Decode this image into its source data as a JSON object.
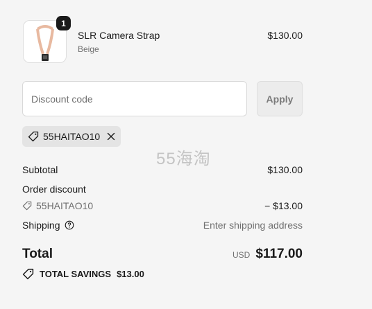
{
  "product": {
    "quantity": "1",
    "name": "SLR Camera Strap",
    "variant": "Beige",
    "price": "$130.00"
  },
  "discount": {
    "placeholder": "Discount code",
    "value": "",
    "apply_label": "Apply"
  },
  "applied_code": {
    "code": "55HAITAO10",
    "icon": "tag-icon",
    "remove_icon": "close-icon"
  },
  "watermark": "55海淘",
  "summary": {
    "subtotal_label": "Subtotal",
    "subtotal_value": "$130.00",
    "order_discount_label": "Order discount",
    "order_discount_code": "55HAITAO10",
    "order_discount_value": "− $13.00",
    "shipping_label": "Shipping",
    "shipping_value": "Enter shipping address",
    "total_label": "Total",
    "total_currency": "USD",
    "total_amount": "$117.00",
    "savings_label": "TOTAL SAVINGS",
    "savings_value": "$13.00"
  }
}
